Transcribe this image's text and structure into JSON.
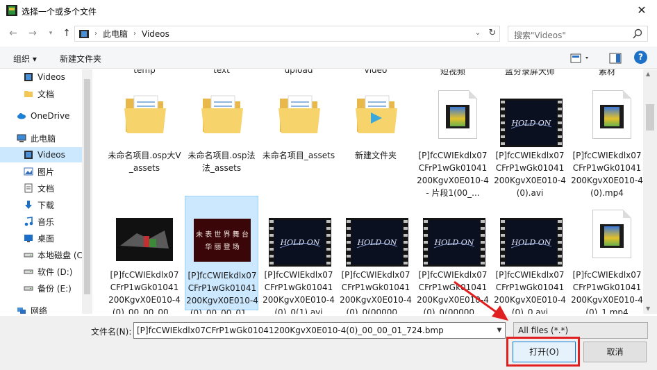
{
  "window": {
    "title": "选择一个或多个文件",
    "close_glyph": "✕"
  },
  "nav": {
    "breadcrumb": [
      "此电脑",
      "Videos"
    ],
    "search_placeholder": "搜索\"Videos\""
  },
  "toolbar": {
    "organize_label": "组织 ▾",
    "new_folder_label": "新建文件夹",
    "help_glyph": "?"
  },
  "sidebar": {
    "items": [
      {
        "label": "Videos",
        "icon": "video-folder-icon"
      },
      {
        "label": "文档",
        "icon": "folder-icon"
      },
      {
        "label": "OneDrive",
        "icon": "cloud-icon"
      },
      {
        "label": "此电脑",
        "icon": "computer-icon"
      },
      {
        "label": "Videos",
        "icon": "video-folder-icon",
        "selected": true
      },
      {
        "label": "图片",
        "icon": "pictures-icon"
      },
      {
        "label": "文档",
        "icon": "documents-icon"
      },
      {
        "label": "下载",
        "icon": "download-icon"
      },
      {
        "label": "音乐",
        "icon": "music-icon"
      },
      {
        "label": "桌面",
        "icon": "desktop-icon"
      },
      {
        "label": "本地磁盘 (C",
        "icon": "drive-icon"
      },
      {
        "label": "软件 (D:)",
        "icon": "drive-icon"
      },
      {
        "label": "备份 (E:)",
        "icon": "drive-icon"
      },
      {
        "label": "网络",
        "icon": "network-icon"
      }
    ]
  },
  "content": {
    "top_labels": [
      "temp",
      "text",
      "upload",
      "video",
      "短视频",
      "蓝穷录屏大师",
      "素材"
    ],
    "row1": [
      {
        "label": "未命名项目.osp大V_assets",
        "kind": "folder"
      },
      {
        "label": "未命名项目.osp法法_assets",
        "kind": "folder"
      },
      {
        "label": "未命名项目_assets",
        "kind": "folder"
      },
      {
        "label": "新建文件夹",
        "kind": "media-folder"
      },
      {
        "label": "[P]fcCWIEkdlx07CFrP1wGk01041200KgvX0E010-4 - 片段1(00_...",
        "kind": "doc"
      },
      {
        "label": "[P]fcCWIEkdlx07CFrP1wGk01041200KgvX0E010-4(0).avi",
        "kind": "film"
      },
      {
        "label": "[P]fcCWIEkdlx07CFrP1wGk01041200KgvX0E010-4(0).mp4",
        "kind": "doc"
      }
    ],
    "row2": [
      {
        "label": "[P]fcCWIEkdlx07CFrP1wGk01041200KgvX0E010-4(0)_00_00_00...",
        "kind": "thumb1"
      },
      {
        "label": "[P]fcCWIEkdlx07CFrP1wGk01041200KgvX0E010-4(0)_00_00_01...",
        "kind": "thumb2",
        "selected": true
      },
      {
        "label": "[P]fcCWIEkdlx07CFrP1wGk01041200KgvX0E010-4(0)_0(1).avi",
        "kind": "film"
      },
      {
        "label": "[P]fcCWIEkdlx07CFrP1wGk01041200KgvX0E010-4(0)_0(00000...",
        "kind": "film"
      },
      {
        "label": "[P]fcCWIEkdlx07CFrP1wGk01041200KgvX0E010-4(0)_0(00000...",
        "kind": "film"
      },
      {
        "label": "[P]fcCWIEkdlx07CFrP1wGk01041200KgvX0E010-4(0)_0.avi",
        "kind": "film"
      },
      {
        "label": "[P]fcCWIEkdlx07CFrP1wGk01041200KgvX0E010-4(0)_1.mp4",
        "kind": "doc"
      }
    ],
    "thumb_texts": {
      "hold_on": "HOLD ON",
      "chinese_art": "未 表 世 界 舞 台 华 丽 登 场"
    }
  },
  "footer": {
    "filename_label": "文件名(N):",
    "filename_value": "[P]fcCWIEkdlx07CFrP1wGk01041200KgvX0E010-4(0)_00_00_01_724.bmp",
    "filter_value": "All files (*.*)",
    "open_label": "打开(O)",
    "cancel_label": "取消"
  },
  "colors": {
    "selection": "#cce8ff",
    "accent": "#0078d7",
    "annotation": "#e02020"
  }
}
